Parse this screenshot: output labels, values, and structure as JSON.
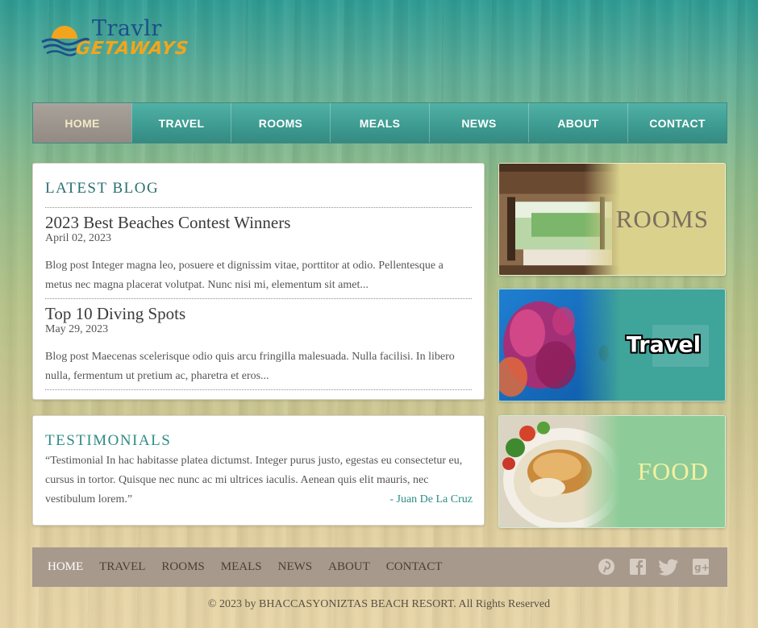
{
  "logo": {
    "line1": "Travlr",
    "line2": "Getaways"
  },
  "nav": {
    "items": [
      {
        "label": "HOME",
        "active": true
      },
      {
        "label": "TRAVEL"
      },
      {
        "label": "ROOMS"
      },
      {
        "label": "MEALS"
      },
      {
        "label": "NEWS"
      },
      {
        "label": "ABOUT"
      },
      {
        "label": "CONTACT"
      }
    ]
  },
  "blog": {
    "heading": "LATEST BLOG",
    "posts": [
      {
        "title": "2023 Best Beaches Contest Winners",
        "date": "April 02, 2023",
        "excerpt": "Blog post Integer magna leo, posuere et dignissim vitae, porttitor at odio. Pellentesque a metus nec magna placerat volutpat. Nunc nisi mi, elementum sit amet..."
      },
      {
        "title": "Top 10 Diving Spots",
        "date": "May 29, 2023",
        "excerpt": "Blog post Maecenas scelerisque odio quis arcu fringilla malesuada. Nulla facilisi. In libero nulla, fermentum ut pretium ac, pharetra et eros..."
      }
    ]
  },
  "testimonials": {
    "heading": "TESTIMONIALS",
    "quote": "“Testimonial In hac habitasse platea dictumst. Integer purus justo, egestas eu consectetur eu, cursus in tortor. Quisque nec nunc ac mi ultrices iaculis. Aenean quis elit mauris, nec vestibulum lorem.”",
    "author": "- Juan De La Cruz"
  },
  "tiles": {
    "rooms": "ROOMS",
    "travel": "Travel",
    "food": "FOOD"
  },
  "footer": {
    "links": [
      "HOME",
      "TRAVEL",
      "ROOMS",
      "MEALS",
      "NEWS",
      "ABOUT",
      "CONTACT"
    ],
    "social_icons": [
      "pinterest-icon",
      "facebook-icon",
      "twitter-icon",
      "google-plus-icon"
    ],
    "copyright": "© 2023 by BHACCASYONIZTAS BEACH RESORT. All Rights Reserved"
  },
  "colors": {
    "nav_teal": "#3e9c92",
    "nav_active": "#928a83",
    "heading_teal": "#2d6f72",
    "footer_bar": "#a8998d",
    "rooms_tile": "#d9d18c",
    "travel_tile": "#3fa49a",
    "food_tile": "#8dcc98"
  }
}
